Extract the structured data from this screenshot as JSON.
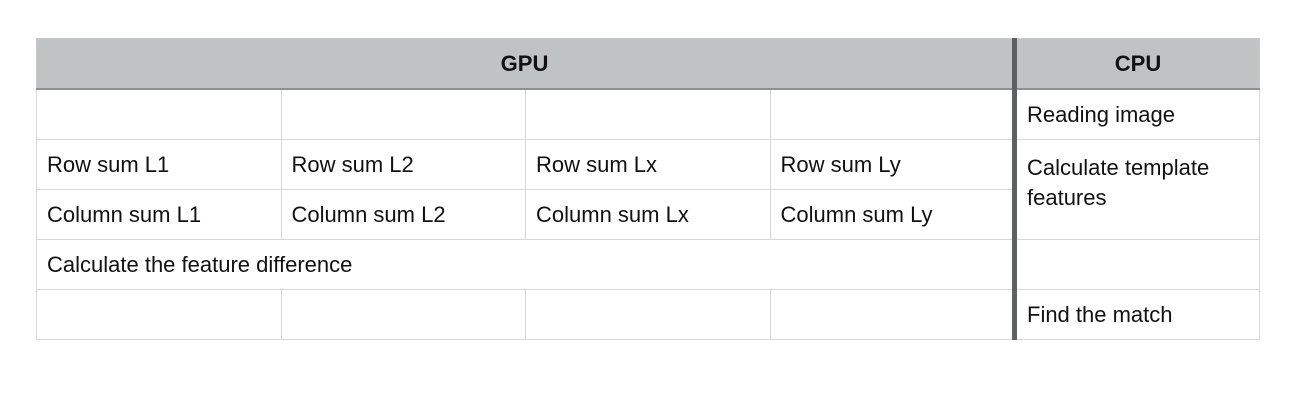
{
  "table": {
    "headers": {
      "gpu": "GPU",
      "cpu": "CPU"
    },
    "rows": [
      {
        "gpu": [
          "",
          "",
          "",
          ""
        ],
        "cpu": "Reading image"
      },
      {
        "gpu": [
          "Row sum L1",
          "Row sum L2",
          "Row sum Lx",
          "Row sum Ly"
        ],
        "cpu": "Calculate template features"
      },
      {
        "gpu": [
          "Column sum L1",
          "Column sum L2",
          "Column sum Lx",
          "Column sum Ly"
        ],
        "cpu": ""
      },
      {
        "gpu_merged": "Calculate the feature difference",
        "cpu": ""
      },
      {
        "gpu": [
          "",
          "",
          "",
          ""
        ],
        "cpu": "Find the match"
      }
    ]
  }
}
